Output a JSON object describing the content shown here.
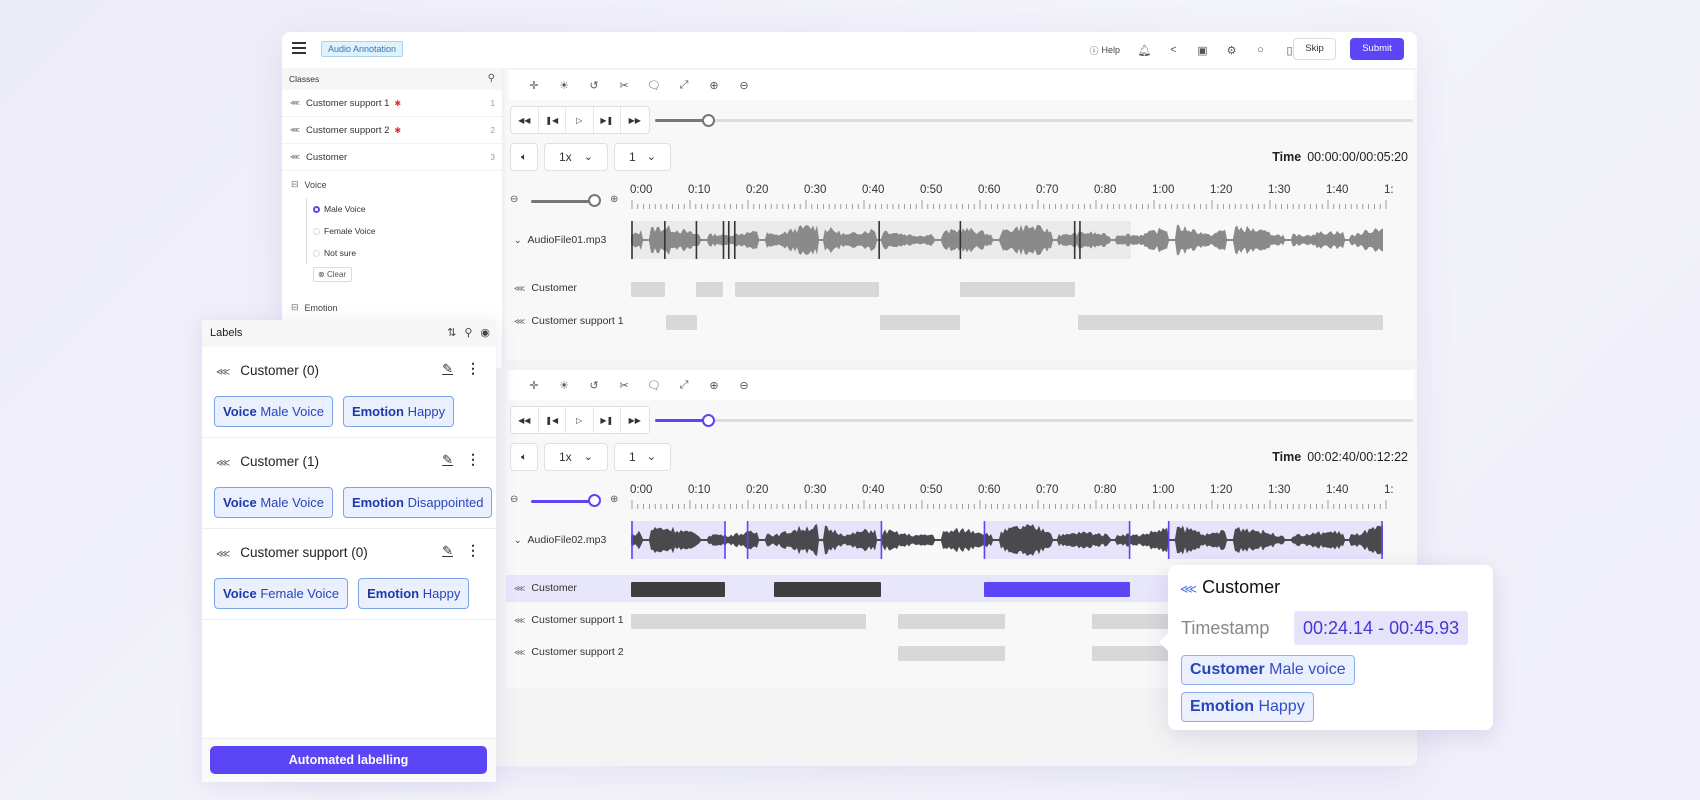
{
  "header": {
    "app_badge": "Audio Annotation",
    "help_label": "Help",
    "skip_label": "Skip",
    "submit_label": "Submit",
    "icons": [
      "help-icon",
      "bell-icon",
      "share-icon",
      "save-icon",
      "gear-icon",
      "chat-icon",
      "info-file-icon"
    ]
  },
  "classes": {
    "title": "Classes",
    "items": [
      {
        "label": "Customer support 1",
        "count": "1",
        "required": true
      },
      {
        "label": "Customer support 2",
        "count": "2",
        "required": true
      },
      {
        "label": "Customer",
        "count": "3",
        "required": false
      }
    ],
    "groups": {
      "voice": {
        "label": "Voice",
        "options": [
          {
            "label": "Male Voice",
            "selected": true
          },
          {
            "label": "Female Voice",
            "selected": false
          },
          {
            "label": "Not sure",
            "selected": false
          }
        ],
        "clear_label": "Clear"
      },
      "emotion": {
        "label": "Emotion"
      }
    }
  },
  "players": [
    {
      "speed": "1x",
      "channel": "1",
      "time_label": "Time",
      "time_value": "00:00:00/00:05:20",
      "seek_progress": 0.07,
      "zoom_level": 1.0,
      "accent": "#777777",
      "file_name": "AudioFile01.mp3",
      "ruler": [
        "0:00",
        "0:10",
        "0:20",
        "0:30",
        "0:40",
        "0:50",
        "0:60",
        "0:70",
        "0:80",
        "1:00",
        "1:20",
        "1:30",
        "1:40",
        "1:"
      ],
      "tracks": [
        {
          "label": "Customer",
          "segments": [
            [
              0.0,
              0.045
            ],
            [
              0.087,
              0.123
            ],
            [
              0.138,
              0.33
            ],
            [
              0.438,
              0.59
            ]
          ]
        },
        {
          "label": "Customer support 1",
          "segments": [
            [
              0.046,
              0.088
            ],
            [
              0.331,
              0.437
            ],
            [
              0.595,
              1.0
            ]
          ]
        }
      ]
    },
    {
      "speed": "1x",
      "channel": "1",
      "time_label": "Time",
      "time_value": "00:02:40/00:12:22",
      "seek_progress": 0.07,
      "zoom_level": 1.0,
      "accent": "#5b45f4",
      "file_name": "AudioFile02.mp3",
      "ruler": [
        "0:00",
        "0:10",
        "0:20",
        "0:30",
        "0:40",
        "0:50",
        "0:60",
        "0:70",
        "0:80",
        "1:00",
        "1:20",
        "1:30",
        "1:40",
        "1:"
      ],
      "tracks": [
        {
          "label": "Customer",
          "highlighted": true,
          "segments": [
            [
              0.0,
              0.125,
              "dark"
            ],
            [
              0.19,
              0.333,
              "dark"
            ],
            [
              0.47,
              0.663,
              "accent"
            ]
          ]
        },
        {
          "label": "Customer support 1",
          "segments": [
            [
              0.0,
              0.312
            ],
            [
              0.355,
              0.498
            ],
            [
              0.613,
              1.0
            ]
          ]
        },
        {
          "label": "Customer support 2",
          "segments": [
            [
              0.355,
              0.498
            ],
            [
              0.613,
              1.0
            ]
          ]
        }
      ]
    }
  ],
  "labels_panel": {
    "title": "Labels",
    "items": [
      {
        "title": "Customer (0)",
        "chips": [
          {
            "key": "Voice",
            "value": "Male Voice"
          },
          {
            "key": "Emotion",
            "value": "Happy"
          }
        ]
      },
      {
        "title": "Customer (1)",
        "chips": [
          {
            "key": "Voice",
            "value": "Male Voice"
          },
          {
            "key": "Emotion",
            "value": "Disappointed"
          }
        ]
      },
      {
        "title": "Customer support (0)",
        "chips": [
          {
            "key": "Voice",
            "value": "Female Voice"
          },
          {
            "key": "Emotion",
            "value": "Happy"
          }
        ]
      }
    ],
    "auto_button": "Automated labelling"
  },
  "tooltip": {
    "title": "Customer",
    "timestamp_label": "Timestamp",
    "timestamp_value": "00:24.14 - 00:45.93",
    "chips": [
      {
        "key": "Customer",
        "value": "Male voice"
      },
      {
        "key": "Emotion",
        "value": "Happy"
      }
    ]
  }
}
